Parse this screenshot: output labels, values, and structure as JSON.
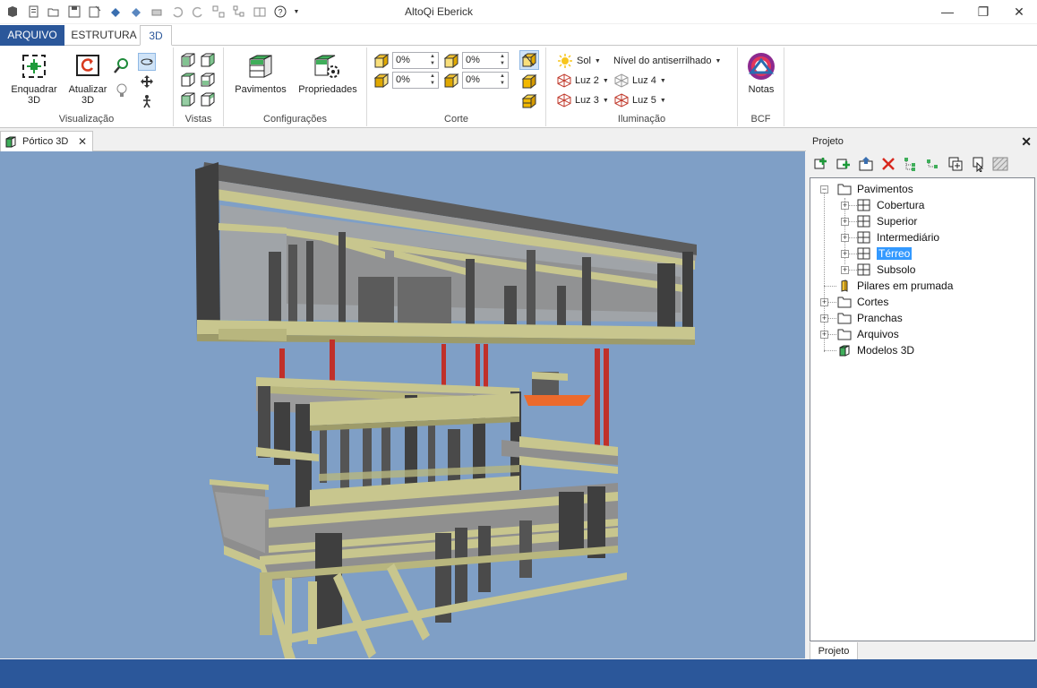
{
  "window": {
    "title": "AltoQi Eberick",
    "minimize": "—",
    "restore": "❐",
    "close": "✕"
  },
  "tabs": [
    {
      "label": "ARQUIVO"
    },
    {
      "label": "ESTRUTURA"
    },
    {
      "label": "3D"
    }
  ],
  "ribbon": {
    "visualizacao": {
      "label": "Visualização",
      "enquadrar_line1": "Enquadrar",
      "enquadrar_line2": "3D",
      "atualizar_line1": "Atualizar",
      "atualizar_line2": "3D"
    },
    "vistas": {
      "label": "Vistas"
    },
    "configuracoes": {
      "label": "Configurações",
      "pavimentos": "Pavimentos",
      "propriedades": "Propriedades"
    },
    "corte": {
      "label": "Corte",
      "values": [
        "0%",
        "0%",
        "0%",
        "0%"
      ]
    },
    "iluminacao": {
      "label": "Iluminação",
      "sol": "Sol",
      "antialias": "Nível do antiserrilhado",
      "luz2": "Luz 2",
      "luz3": "Luz 3",
      "luz4": "Luz 4",
      "luz5": "Luz 5"
    },
    "bcf": {
      "label": "BCF",
      "notas": "Notas"
    }
  },
  "document_tab": {
    "label": "Pórtico 3D"
  },
  "panel": {
    "title": "Projeto",
    "footer_tab": "Projeto",
    "tree": {
      "pavimentos": "Pavimentos",
      "cobertura": "Cobertura",
      "superior": "Superior",
      "intermediario": "Intermediário",
      "terreo": "Térreo",
      "subsolo": "Subsolo",
      "pilares": "Pilares em prumada",
      "cortes": "Cortes",
      "pranchas": "Pranchas",
      "arquivos": "Arquivos",
      "modelos3d": "Modelos 3D"
    }
  },
  "colors": {
    "accent": "#2b579a",
    "viewport_bg": "#7f9fc6",
    "beam": "#c8c68e",
    "column": "#4a4a4a",
    "slab": "#9e9e9e",
    "pillar_red": "#c0302a",
    "highlight_orange": "#ec6a2c"
  }
}
